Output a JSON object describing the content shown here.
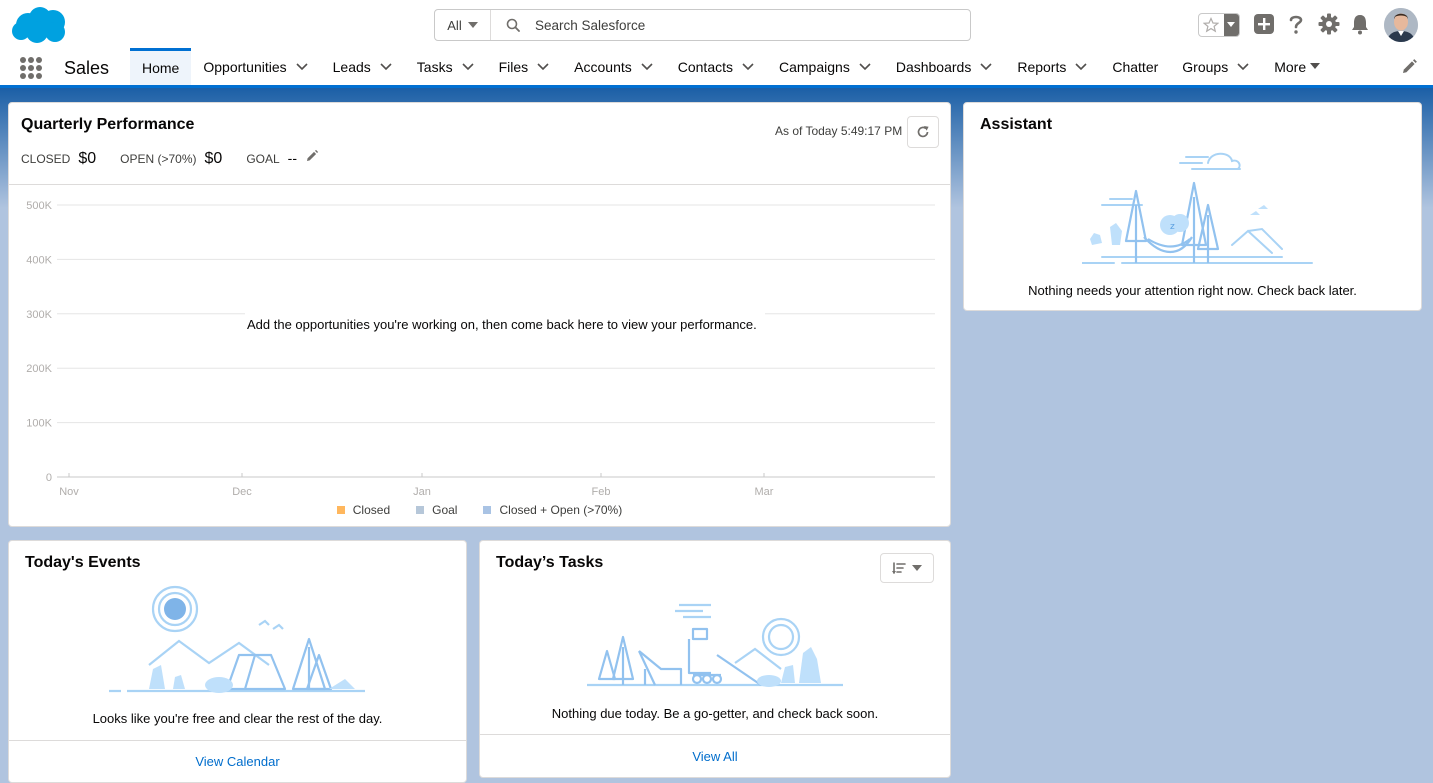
{
  "header": {
    "logo_icon": "salesforce-cloud-logo",
    "search": {
      "scope": "All",
      "placeholder": "Search Salesforce"
    },
    "icons": [
      "favorites-star-icon",
      "global-add-icon",
      "help-icon",
      "setup-gear-icon",
      "notifications-bell-icon"
    ],
    "avatar": "user-avatar"
  },
  "nav": {
    "app_name": "Sales",
    "tabs": [
      {
        "label": "Home",
        "active": true,
        "has_menu": false
      },
      {
        "label": "Opportunities",
        "has_menu": true
      },
      {
        "label": "Leads",
        "has_menu": true
      },
      {
        "label": "Tasks",
        "has_menu": true
      },
      {
        "label": "Files",
        "has_menu": true
      },
      {
        "label": "Accounts",
        "has_menu": true
      },
      {
        "label": "Contacts",
        "has_menu": true
      },
      {
        "label": "Campaigns",
        "has_menu": true
      },
      {
        "label": "Dashboards",
        "has_menu": true
      },
      {
        "label": "Reports",
        "has_menu": true
      },
      {
        "label": "Chatter",
        "has_menu": false
      },
      {
        "label": "Groups",
        "has_menu": true
      },
      {
        "label": "More",
        "has_menu": true,
        "more": true
      }
    ]
  },
  "quarterly": {
    "title": "Quarterly Performance",
    "as_of": "As of Today 5:49:17 PM",
    "closed_label": "CLOSED",
    "closed_value": "$0",
    "open_label": "OPEN (>70%)",
    "open_value": "$0",
    "goal_label": "GOAL",
    "goal_value": "--",
    "empty_message": "Add the opportunities you're working on, then come back here to view your performance."
  },
  "chart_data": {
    "type": "line",
    "x": [
      "Nov",
      "Dec",
      "Jan",
      "Feb",
      "Mar"
    ],
    "yticks": [
      "0",
      "100K",
      "200K",
      "300K",
      "400K",
      "500K"
    ],
    "ylim": [
      0,
      500000
    ],
    "series": [
      {
        "name": "Closed",
        "color": "#ffb75d",
        "values": []
      },
      {
        "name": "Goal",
        "color": "#b6c7d9",
        "values": []
      },
      {
        "name": "Closed + Open (>70%)",
        "color": "#a9c3e4",
        "values": []
      }
    ],
    "grid": true,
    "legend": "bottom"
  },
  "assistant": {
    "title": "Assistant",
    "message": "Nothing needs your attention right now. Check back later."
  },
  "events": {
    "title": "Today's Events",
    "message": "Looks like you're free and clear the rest of the day.",
    "footer_link": "View Calendar"
  },
  "tasks": {
    "title": "Today’s Tasks",
    "message": "Nothing due today. Be a go-getter, and check back soon.",
    "footer_link": "View All"
  },
  "colors": {
    "brand": "#0070d2",
    "link": "#006dcc",
    "page_bg": "#b0c4df"
  }
}
